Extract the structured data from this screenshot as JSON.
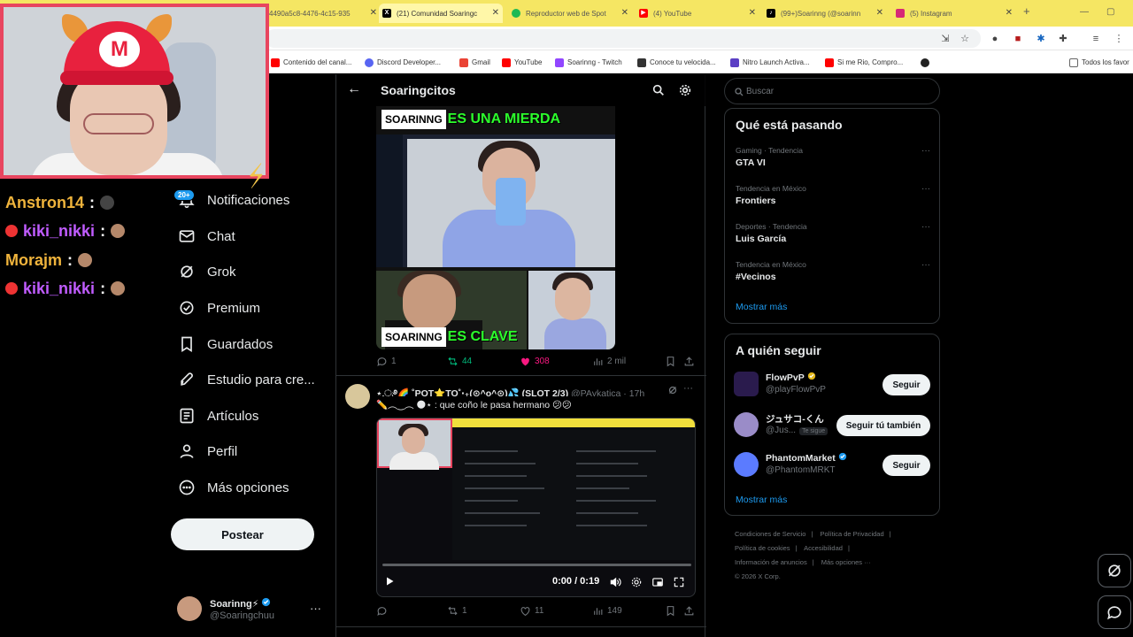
{
  "browser": {
    "tabs": [
      {
        "label": "4490a5c8-4476-4c15-935",
        "color": "#f5e663"
      },
      {
        "label": "(21) Comunidad Soaringc",
        "color": "#000000",
        "icon": "X",
        "active": true
      },
      {
        "label": "Reproductor web de Spot",
        "color": "#1db954"
      },
      {
        "label": "(4) YouTube",
        "color": "#ff0000"
      },
      {
        "label": "(99+)Soarinng (@soarinn",
        "color": "#000000",
        "icon": "♪"
      },
      {
        "label": "(5) Instagram",
        "color": "#d62976"
      }
    ],
    "new_tab": "+",
    "bookmarks": [
      {
        "label": "Contenido del canal...",
        "color": "#ff0000"
      },
      {
        "label": "Discord Developer...",
        "color": "#5865f2"
      },
      {
        "label": "Gmail",
        "color": "#ea4335"
      },
      {
        "label": "YouTube",
        "color": "#ff0000"
      },
      {
        "label": "Soarinng - Twitch",
        "color": "#9146ff"
      },
      {
        "label": "Conoce tu velocida...",
        "color": "#333333"
      },
      {
        "label": "Nitro Launch Activa...",
        "color": "#5b3fc4"
      },
      {
        "label": "Si me Rio, Compro...",
        "color": "#ff0000"
      },
      {
        "label": "Todos los favor",
        "color": "#666666"
      }
    ]
  },
  "overlay": {
    "chat": [
      {
        "user": "Anstron14",
        "color": "#f0b43c",
        "badge": false
      },
      {
        "user": "kiki_nikki",
        "color": "#c05cff",
        "badge": true
      },
      {
        "user": "Morajm",
        "color": "#f0b43c",
        "badge": false
      },
      {
        "user": "kiki_nikki",
        "color": "#c05cff",
        "badge": true
      }
    ],
    "colon": ":"
  },
  "nav": {
    "notif_badge": "20+",
    "items": [
      {
        "label": "Notificaciones",
        "icon": "bell-icon"
      },
      {
        "label": "Chat",
        "icon": "mail-icon"
      },
      {
        "label": "Grok",
        "icon": "grok-icon"
      },
      {
        "label": "Premium",
        "icon": "premium-icon"
      },
      {
        "label": "Guardados",
        "icon": "bookmark-icon"
      },
      {
        "label": "Estudio para cre...",
        "icon": "rocket-icon"
      },
      {
        "label": "Artículos",
        "icon": "article-icon"
      },
      {
        "label": "Perfil",
        "icon": "person-icon"
      },
      {
        "label": "Más opciones",
        "icon": "more-circle-icon"
      }
    ],
    "post_button": "Postear",
    "profile": {
      "name": "Soarinng⚡",
      "handle": "@Soaringchuu",
      "more": "···"
    }
  },
  "main": {
    "title": "Soaringcitos",
    "post1": {
      "caption_top_white": "SOARINNG",
      "caption_top_green": "ES UNA MIERDA",
      "caption_bottom_white": "SOARINNG",
      "caption_bottom_green": "ES CLAVE",
      "replies": "1",
      "reposts": "44",
      "likes": "308",
      "views": "2 mil"
    },
    "post2": {
      "display_name": "⋆.ೃ࿔🌈 ˚POT⭐TO˚‧₊(⊙^o^⊙)💦 (SLOT 2/3)",
      "handle": "@PAykatica · 17h",
      "text": "✏️︵‿︵ 🌑⋆ : que coño le pasa hermano 😕😕",
      "video_time": "0:00 / 0:19",
      "video_progress": 0.0,
      "replies": "",
      "reposts": "1",
      "likes": "11",
      "views": "149"
    }
  },
  "right": {
    "search_placeholder": "Buscar",
    "trends_title": "Qué está pasando",
    "trends": [
      {
        "meta": "Gaming · Tendencia",
        "name": "GTA VI"
      },
      {
        "meta": "Tendencia en México",
        "name": "Frontiers"
      },
      {
        "meta": "Deportes · Tendencia",
        "name": "Luis García"
      },
      {
        "meta": "Tendencia en México",
        "name": "#Vecinos"
      }
    ],
    "show_more": "Mostrar más",
    "who_title": "A quién seguir",
    "who": [
      {
        "name": "FlowPvP",
        "handle": "@playFlowPvP",
        "button": "Seguir",
        "verified": "gold",
        "color": "#2a1b4d"
      },
      {
        "name": "ジュサコ-くん",
        "handle": "@Jus...",
        "tag": "Te sigue",
        "button": "Seguir tú también",
        "color": "#9a8cc8"
      },
      {
        "name": "PhantomMarket",
        "handle": "@PhantomMRKT",
        "button": "Seguir",
        "verified": "blue",
        "color": "#5b7bff"
      }
    ],
    "footer": [
      "Condiciones de Servicio",
      "Política de Privacidad",
      "Política de cookies",
      "Accesibilidad",
      "Información de anuncios",
      "Más opciones ···",
      "© 2026 X Corp."
    ]
  }
}
